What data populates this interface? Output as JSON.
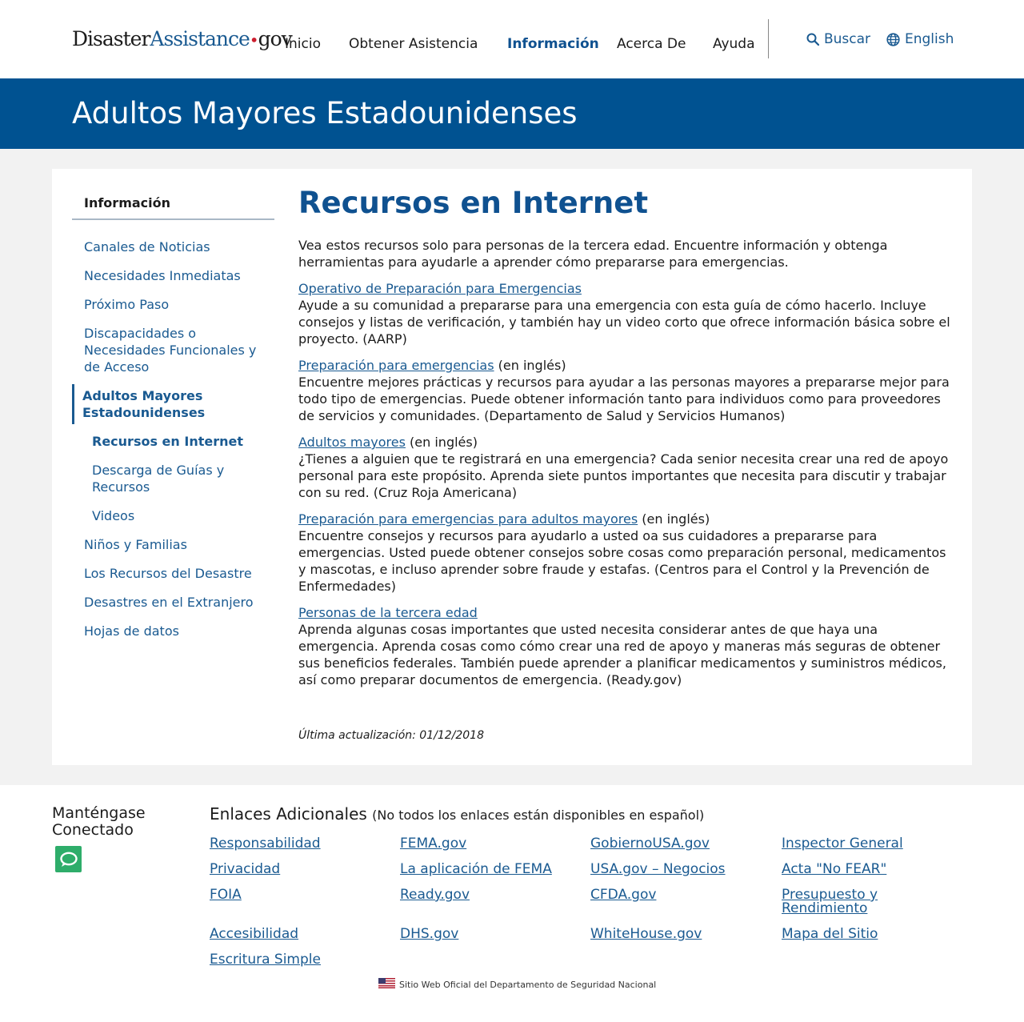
{
  "header": {
    "logo": {
      "part1": "Disaster",
      "part2": "Assistance",
      "dot": "•",
      "part3": "gov"
    },
    "nav": [
      "Inicio",
      "Obtener Asistencia",
      "Información",
      "Acerca De",
      "Ayuda"
    ],
    "search_label": "Buscar",
    "language_label": "English"
  },
  "banner": {
    "title": "Adultos Mayores Estadounidenses"
  },
  "sidebar": {
    "title": "Información",
    "items": [
      "Canales de Noticias",
      "Necesidades Inmediatas",
      "Próximo Paso",
      "Discapacidades o Necesidades Funcionales y de Acceso",
      "Adultos Mayores Estadounidenses",
      "Recursos en Internet",
      "Descarga de Guías y Recursos",
      "Videos",
      "Niños y Familias",
      "Los Recursos del Desastre",
      "Desastres en el Extranjero",
      "Hojas de datos"
    ]
  },
  "content": {
    "title": "Recursos en Internet",
    "intro": "Vea estos recursos solo para personas de la tercera edad. Encuentre información y obtenga herramientas para ayudarle a aprender cómo prepararse para emergencias.",
    "entries": [
      {
        "link": "Operativo de Preparación para Emergencias",
        "suffix": "",
        "text": "Ayude a su comunidad a prepararse para una emergencia con esta guía de cómo hacerlo. Incluye consejos y listas de verificación, y también hay un video corto que ofrece información básica sobre el proyecto. (AARP)"
      },
      {
        "link": "Preparación para emergencias",
        "suffix": " (en inglés)",
        "text": "Encuentre mejores prácticas y recursos para ayudar a las personas mayores a prepararse mejor para todo tipo de emergencias. Puede obtener información tanto para individuos como para proveedores de servicios y comunidades. (Departamento de Salud y Servicios Humanos)"
      },
      {
        "link": "Adultos mayores",
        "suffix": " (en inglés)",
        "text": "¿Tienes a alguien que te registrará en una emergencia? Cada senior necesita crear una red de apoyo personal para este propósito. Aprenda siete puntos importantes que necesita para discutir y trabajar con su red. (Cruz Roja Americana)"
      },
      {
        "link": "Preparación para emergencias para adultos mayores",
        "suffix": " (en inglés)",
        "text": "Encuentre consejos y recursos para ayudarlo a usted oa sus cuidadores a prepararse para emergencias. Usted puede obtener consejos sobre cosas como preparación personal, medicamentos y mascotas, e incluso aprender sobre fraude y estafas. (Centros para el Control y la Prevención de Enfermedades)"
      },
      {
        "link": "Personas de la tercera edad",
        "suffix": "",
        "text": "Aprenda algunas cosas importantes que usted necesita considerar antes de que haya una emergencia. Aprenda cosas como cómo crear una red de apoyo y maneras más seguras de obtener sus beneficios federales. También puede aprender a planificar medicamentos y suministros médicos, así como preparar documentos de emergencia. (Ready.gov)"
      }
    ],
    "updated": "Última actualización: 01/12/2018"
  },
  "footer": {
    "stay_connected": "Manténgase Conectado",
    "links_title": "Enlaces Adicionales",
    "links_note": "(No todos los enlaces están disponibles en español)",
    "links": [
      "Responsabilidad",
      "FEMA.gov",
      "GobiernoUSA.gov",
      "Inspector General",
      "Privacidad",
      "La aplicación de FEMA",
      "USA.gov – Negocios",
      "Acta \"No FEAR\"",
      "FOIA",
      "Ready.gov",
      "CFDA.gov",
      "Presupuesto y Rendimiento",
      "Accesibilidad",
      "DHS.gov",
      "WhiteHouse.gov",
      "Mapa del Sitio",
      "Escritura Simple"
    ],
    "official": "Sitio Web Oficial del Departamento de Seguridad Nacional"
  },
  "colors": {
    "banner": "#005291",
    "link": "#1a5a91",
    "logo_dot": "#cc1f2f",
    "chat_icon": "#2ead6a",
    "page_bg": "#f2f2f2"
  },
  "icons": [
    "search-icon",
    "globe-icon",
    "chat-icon",
    "us-flag-icon"
  ]
}
